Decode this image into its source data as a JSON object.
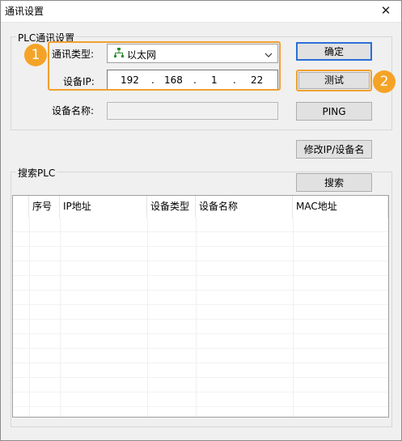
{
  "window": {
    "title": "通讯设置",
    "close_glyph": "✕"
  },
  "plc_settings": {
    "legend": "PLC通讯设置",
    "comm_type_label": "通讯类型:",
    "comm_type_value": "以太网",
    "device_ip_label": "设备IP:",
    "ip_octets": [
      "192",
      "168",
      "1",
      "22"
    ],
    "ip_dot": ".",
    "device_name_label": "设备名称:",
    "device_name_value": ""
  },
  "buttons": {
    "confirm": "确定",
    "test": "测试",
    "ping": "PING",
    "modify": "修改IP/设备名",
    "search": "搜索"
  },
  "search_plc": {
    "legend": "搜索PLC",
    "columns": [
      "序号",
      "IP地址",
      "设备类型",
      "设备名称",
      "MAC地址"
    ],
    "rows": []
  },
  "annotations": {
    "badge1": "1",
    "badge2": "2",
    "accent_color": "#f5a327"
  },
  "icons": {
    "network": "network-icon",
    "dropdown": "chevron-down-icon"
  }
}
